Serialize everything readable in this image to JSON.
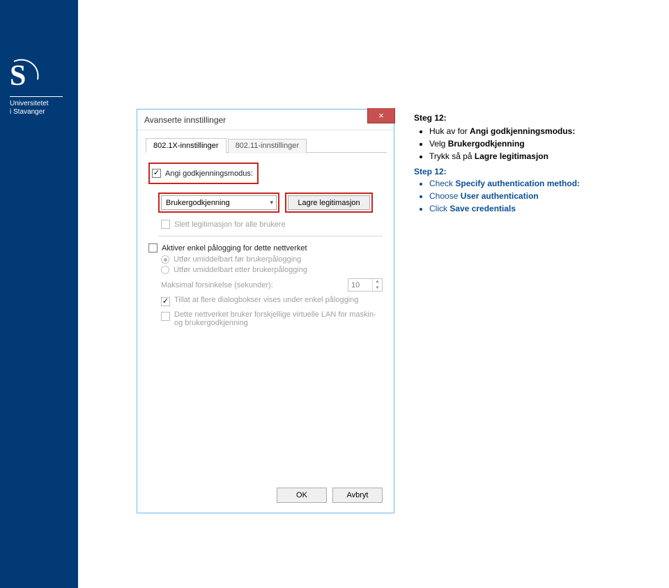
{
  "sidebar": {
    "org_line1": "Universitetet",
    "org_line2": "i Stavanger"
  },
  "dialog": {
    "title": "Avanserte innstillinger",
    "close_icon": "×",
    "tabs": {
      "t0": "802.1X-innstillinger",
      "t1": "802.11-innstillinger"
    },
    "angi_label": "Angi godkjenningsmodus:",
    "dropdown_value": "Brukergodkjenning",
    "save_creds_btn": "Lagre legitimasjon",
    "delete_creds_label": "Slett legitimasjon for alle brukere",
    "sso_label": "Aktiver enkel pålogging for dette nettverket",
    "radio_before": "Utfør umiddelbart før brukerpålogging",
    "radio_after": "Utfør umiddelbart etter brukerpålogging",
    "delay_label": "Maksimal forsinkelse (sekunder):",
    "delay_value": "10",
    "allow_dialogs": "Tillat at flere dialogbokser vises under enkel pålogging",
    "vlan_label": "Dette nettverket bruker forskjellige virtuelle LAN for maskin- og brukergodkjenning",
    "ok": "OK",
    "cancel": "Avbryt"
  },
  "instructions": {
    "no_header": "Steg 12:",
    "no_li1_prefix": "Huk av for ",
    "no_li1_bold": "Angi godkjenningsmodus:",
    "no_li2_prefix": "Velg ",
    "no_li2_bold": "Brukergodkjenning",
    "no_li3_prefix": "Trykk så på ",
    "no_li3_bold": "Lagre legitimasjon",
    "en_header": "Step 12:",
    "en_li1_prefix": "Check ",
    "en_li1_bold": "Specify authentication method:",
    "en_li2_prefix": "Choose ",
    "en_li2_bold": "User authentication",
    "en_li3_prefix": "Click ",
    "en_li3_bold": "Save credentials"
  }
}
